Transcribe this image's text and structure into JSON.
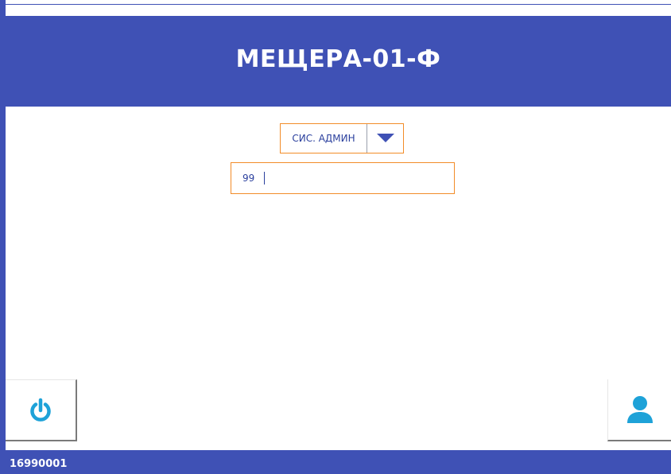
{
  "header": {
    "title": "МЕЩЕРА-01-Ф"
  },
  "login": {
    "role_select": {
      "selected_value": "СИС. АДМИН",
      "icon": "triangle-down-icon"
    },
    "pin_input": {
      "value": "99",
      "placeholder": ""
    }
  },
  "buttons": {
    "power": {
      "icon": "power-icon"
    },
    "user": {
      "icon": "user-icon"
    }
  },
  "footer": {
    "serial": "16990001"
  },
  "colors": {
    "primary": "#3f51b5",
    "accent_border": "#f28c28",
    "icon_blue": "#1ea2d8",
    "text_blue": "#2a3f9d",
    "background": "#ffffff"
  }
}
